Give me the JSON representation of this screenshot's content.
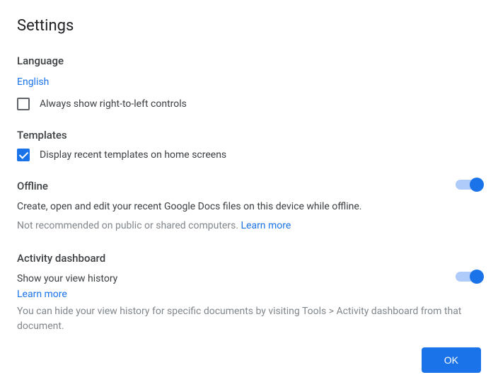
{
  "title": "Settings",
  "language": {
    "header": "Language",
    "value": "English",
    "rtl_label": "Always show right-to-left controls"
  },
  "templates": {
    "header": "Templates",
    "display_label": "Display recent templates on home screens"
  },
  "offline": {
    "header": "Offline",
    "desc": "Create, open and edit your recent Google Docs files on this device while offline.",
    "warning": "Not recommended on public or shared computers. ",
    "learn_more": "Learn more"
  },
  "activity": {
    "header": "Activity dashboard",
    "show_label": "Show your view history",
    "learn_more": "Learn more",
    "hint": "You can hide your view history for specific documents by visiting Tools > Activity dashboard from that document."
  },
  "ok": "OK"
}
